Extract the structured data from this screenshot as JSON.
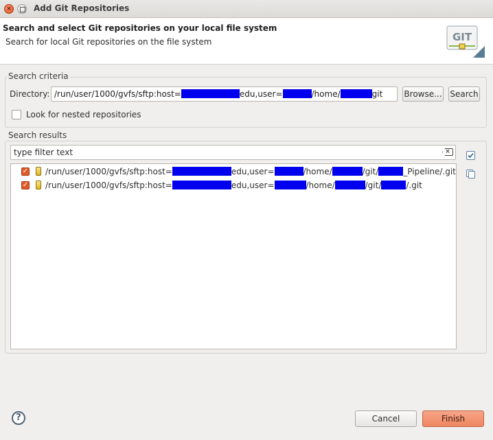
{
  "window": {
    "title": "Add Git Repositories",
    "close_glyph": "×"
  },
  "header": {
    "title": "Search and select Git repositories on your local file system",
    "description": "Search for local Git repositories on the file system",
    "logo_text": "GIT"
  },
  "search_criteria": {
    "group_label": "Search criteria",
    "directory_label": "Directory:",
    "directory_value": {
      "prefix": "/run/user/1000/gvfs/sftp:host=",
      "part2": "edu,user=",
      "part3": "/home/",
      "part4": "git"
    },
    "browse_label": "Browse...",
    "search_label": "Search",
    "nested_label": "Look for nested repositories",
    "nested_checked": false
  },
  "search_results": {
    "group_label": "Search results",
    "filter_placeholder": "type filter text",
    "filter_clear_glyph": "×",
    "rows": [
      {
        "checked": true,
        "prefix": "/run/user/1000/gvfs/sftp:host=",
        "part2": "edu,user=",
        "part3": "/home/",
        "part4": "/git/",
        "suffix": "_Pipeline/.git"
      },
      {
        "checked": true,
        "prefix": "/run/user/1000/gvfs/sftp:host=",
        "part2": "edu,user=",
        "part3": "/home/",
        "part4": "/git/",
        "suffix": "/.git"
      }
    ],
    "check_glyph": "✓"
  },
  "footer": {
    "help_glyph": "?",
    "cancel_label": "Cancel",
    "finish_label": "Finish"
  },
  "colors": {
    "redaction": "#0000ee",
    "finish_button": "#ee8660",
    "checkbox_checked": "#e05a2a"
  }
}
